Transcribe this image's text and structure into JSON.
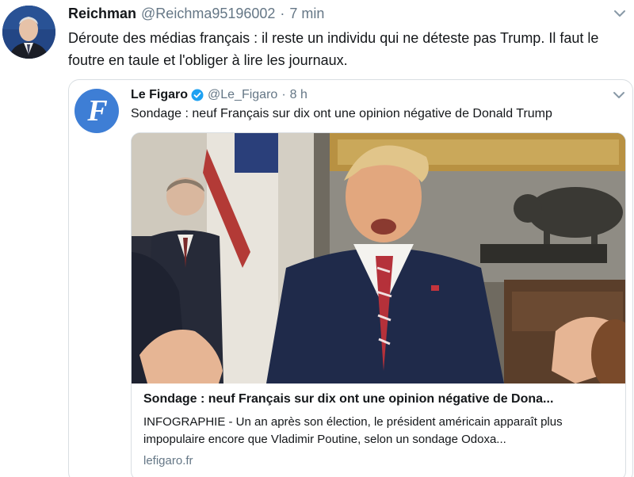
{
  "tweet": {
    "author_name": "Reichman",
    "author_handle": "@Reichma95196002",
    "separator": "·",
    "time": "7 min",
    "text": "Déroute des médias français : il reste un individu qui ne déteste pas  Trump. Il faut le foutre en taule et l'obliger à lire les journaux."
  },
  "quoted_tweet": {
    "author_name": "Le Figaro",
    "author_handle": "@Le_Figaro",
    "separator": "·",
    "time": "8 h",
    "text": "Sondage : neuf Français sur dix ont une opinion négative de Donald Trump",
    "avatar_letter": "F",
    "card": {
      "title": "Sondage : neuf Français sur dix ont une opinion négative de Dona...",
      "description": "INFOGRAPHIE - Un an après son élection, le président américain apparaît plus impopulaire encore que Vladimir Poutine, selon un sondage Odoxa...",
      "domain": "lefigaro.fr"
    }
  },
  "icons": {
    "caret": "chevron-down-icon",
    "verified": "verified-badge-icon"
  },
  "colors": {
    "figaro_blue": "#3e7ed5",
    "verified_blue": "#1da1f2",
    "secondary_text": "#657786",
    "border": "#d9dee2"
  }
}
